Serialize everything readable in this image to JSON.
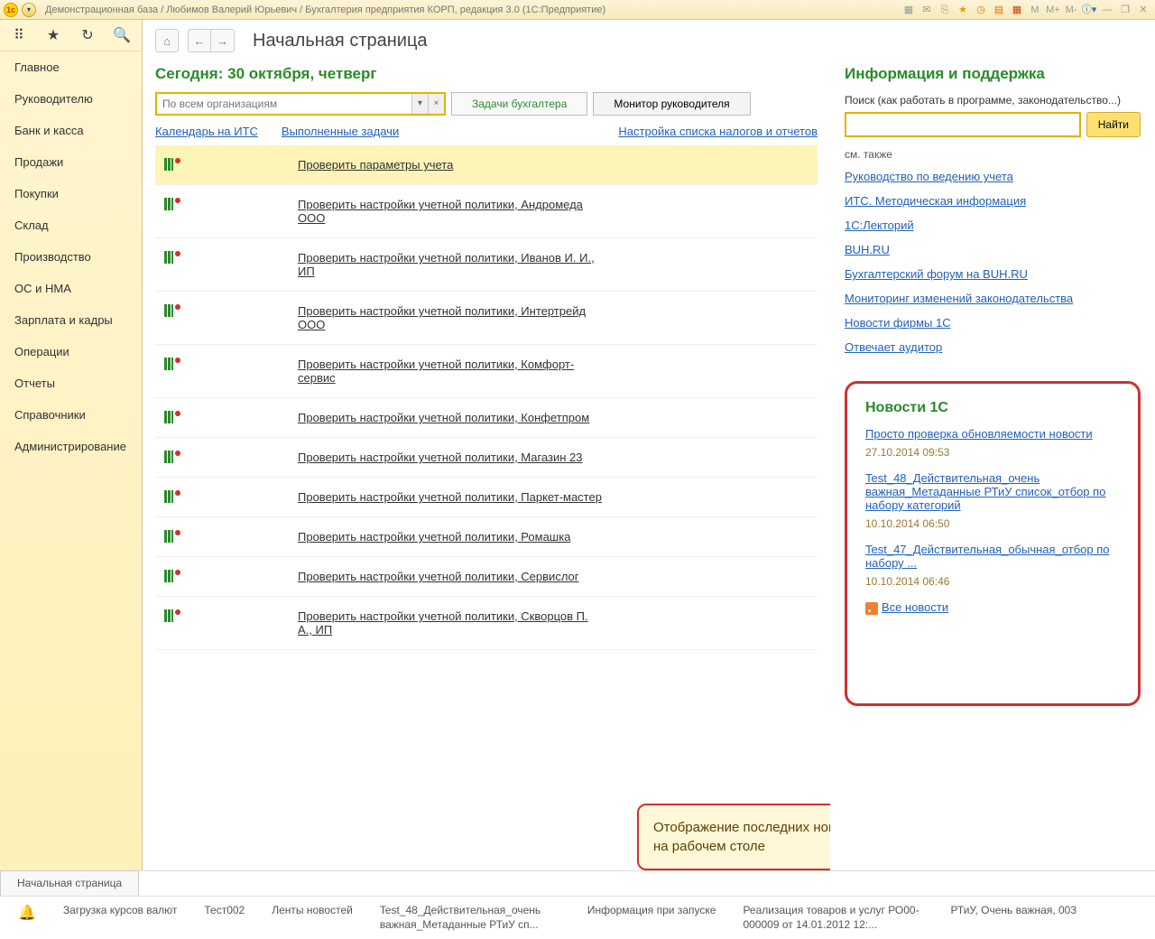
{
  "titlebar": {
    "title": "Демонстрационная база / Любимов Валерий Юрьевич / Бухгалтерия предприятия КОРП, редакция 3.0  (1С:Предприятие)",
    "m1": "M",
    "m2": "M+",
    "m3": "M-"
  },
  "sidebar": {
    "items": [
      "Главное",
      "Руководителю",
      "Банк и касса",
      "Продажи",
      "Покупки",
      "Склад",
      "Производство",
      "ОС и НМА",
      "Зарплата и кадры",
      "Операции",
      "Отчеты",
      "Справочники",
      "Администрирование"
    ]
  },
  "page": {
    "title": "Начальная страница",
    "today": "Сегодня: 30 октября, четверг",
    "org_placeholder": "По всем организациям",
    "tab_tasks": "Задачи бухгалтера",
    "tab_monitor": "Монитор руководителя",
    "link_calendar": "Календарь на ИТС",
    "link_done": "Выполненные задачи",
    "link_settings": "Настройка списка налогов и отчетов"
  },
  "tasks": [
    {
      "t": "Проверить параметры учета",
      "hl": true
    },
    {
      "t": "Проверить настройки учетной политики, Андромеда ООО"
    },
    {
      "t": "Проверить настройки учетной политики, Иванов И. И., ИП"
    },
    {
      "t": "Проверить настройки учетной политики, Интертрейд ООО"
    },
    {
      "t": "Проверить настройки учетной политики, Комфорт-сервис"
    },
    {
      "t": "Проверить настройки учетной политики, Конфетпром"
    },
    {
      "t": "Проверить настройки учетной политики, Магазин 23"
    },
    {
      "t": "Проверить настройки учетной политики, Паркет-мастер"
    },
    {
      "t": "Проверить настройки учетной политики, Ромашка"
    },
    {
      "t": "Проверить настройки учетной политики, Сервислог"
    },
    {
      "t": "Проверить настройки учетной политики, Скворцов П. А., ИП"
    }
  ],
  "right": {
    "title": "Информация и поддержка",
    "search_label": "Поиск (как работать в программе, законодательство...)",
    "search_btn": "Найти",
    "see_also": "см. также",
    "links": [
      "Руководство по ведению учета",
      "ИТС. Методическая информация",
      "1С:Лекторий",
      "BUH.RU",
      "Бухгалтерский форум на BUH.RU",
      "Мониторинг изменений законодательства",
      "Новости фирмы 1С",
      "Отвечает аудитор"
    ]
  },
  "news": {
    "title": "Новости 1С",
    "items": [
      {
        "link": "Просто проверка обновляемости новости",
        "date": "27.10.2014 09:53"
      },
      {
        "link": "Test_48_Действительная_очень важная_Метаданные РТиУ список_отбор по набору категорий",
        "date": "10.10.2014 06:50"
      },
      {
        "link": "Test_47_Действительная_обычная_отбор по набору ...",
        "date": "10.10.2014 06:46"
      }
    ],
    "all": "Все новости"
  },
  "callout": "Отображение последних новостей на рабочем столе",
  "bottom_tab": "Начальная страница",
  "status": [
    "Загрузка курсов валют",
    "Тест002",
    "Ленты новостей",
    "Test_48_Действительная_очень важная_Метаданные РТиУ сп...",
    "Информация при запуске",
    "Реализация товаров и услуг РО00-000009 от 14.01.2012 12:...",
    "РТиУ,  Очень важная, 003"
  ]
}
